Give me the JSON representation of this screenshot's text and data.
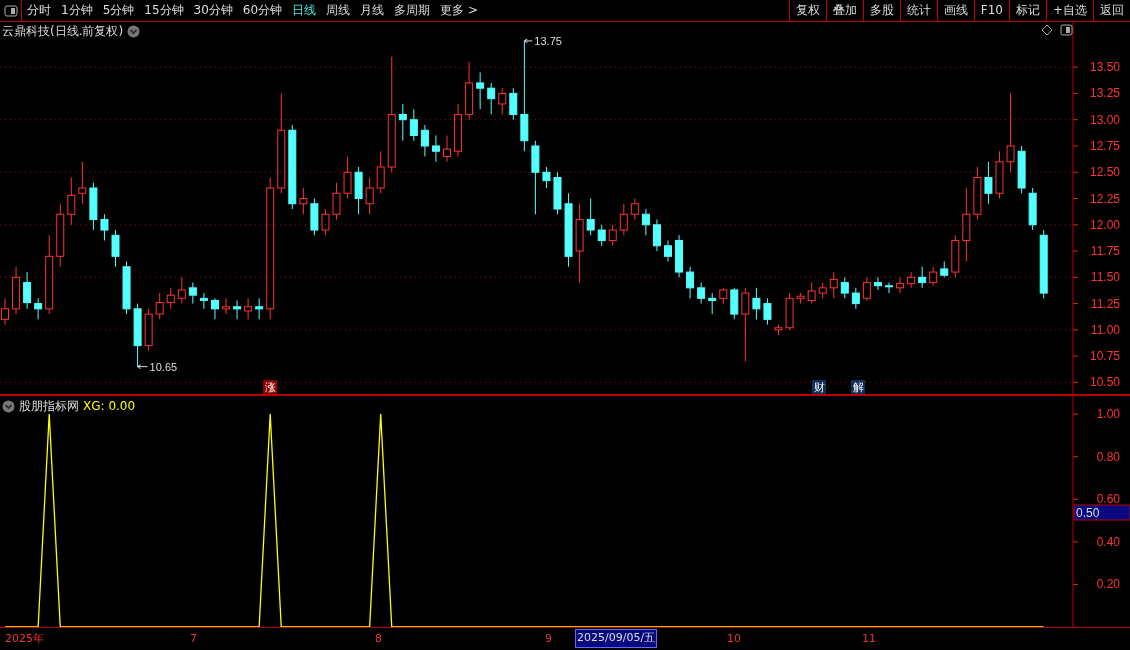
{
  "toolbar": {
    "periods": [
      {
        "label": "分时",
        "selected": false
      },
      {
        "label": "1分钟",
        "selected": false
      },
      {
        "label": "5分钟",
        "selected": false
      },
      {
        "label": "15分钟",
        "selected": false
      },
      {
        "label": "30分钟",
        "selected": false
      },
      {
        "label": "60分钟",
        "selected": false
      },
      {
        "label": "日线",
        "selected": true
      },
      {
        "label": "周线",
        "selected": false
      },
      {
        "label": "月线",
        "selected": false
      },
      {
        "label": "多周期",
        "selected": false
      },
      {
        "label": "更多 >",
        "selected": false
      }
    ],
    "actions": [
      "复权",
      "叠加",
      "多股",
      "统计",
      "画线",
      "F10",
      "标记",
      "+自选",
      "返回"
    ]
  },
  "price_panel": {
    "title": "云鼎科技(日线.前复权)",
    "high_marker": "13.75",
    "low_marker": "10.65",
    "event_badges": [
      {
        "label": "涨",
        "color": "#8b0000"
      },
      {
        "label": "财",
        "color": "#12305a"
      },
      {
        "label": "解",
        "color": "#12305a"
      }
    ],
    "chart_data": {
      "type": "candlestick",
      "grid": true,
      "ylim": [
        10.38,
        13.93
      ],
      "yticks": [
        {
          "value": 13.5,
          "label": "13.50"
        },
        {
          "value": 13.25,
          "label": "13.25"
        },
        {
          "value": 13.0,
          "label": "13.00"
        },
        {
          "value": 12.75,
          "label": "12.75"
        },
        {
          "value": 12.5,
          "label": "12.50"
        },
        {
          "value": 12.25,
          "label": "12.25"
        },
        {
          "value": 12.0,
          "label": "12.00"
        },
        {
          "value": 11.75,
          "label": "11.75"
        },
        {
          "value": 11.5,
          "label": "11.50"
        },
        {
          "value": 11.25,
          "label": "11.25"
        },
        {
          "value": 11.0,
          "label": "11.00"
        },
        {
          "value": 10.75,
          "label": "10.75"
        },
        {
          "value": 10.5,
          "label": "10.50"
        }
      ],
      "ohlc": [
        [
          11.1,
          11.3,
          11.05,
          11.2
        ],
        [
          11.2,
          11.6,
          11.15,
          11.5
        ],
        [
          11.45,
          11.55,
          11.2,
          11.26
        ],
        [
          11.25,
          11.3,
          11.1,
          11.2
        ],
        [
          11.2,
          11.9,
          11.15,
          11.7
        ],
        [
          11.7,
          12.2,
          11.6,
          12.1
        ],
        [
          12.1,
          12.45,
          12.0,
          12.28
        ],
        [
          12.3,
          12.6,
          12.2,
          12.35
        ],
        [
          12.35,
          12.4,
          11.95,
          12.05
        ],
        [
          12.05,
          12.1,
          11.85,
          11.95
        ],
        [
          11.9,
          11.95,
          11.6,
          11.7
        ],
        [
          11.6,
          11.65,
          11.15,
          11.2
        ],
        [
          11.2,
          11.25,
          10.65,
          10.85
        ],
        [
          10.85,
          11.2,
          10.8,
          11.15
        ],
        [
          11.15,
          11.35,
          11.1,
          11.26
        ],
        [
          11.26,
          11.4,
          11.2,
          11.33
        ],
        [
          11.3,
          11.5,
          11.25,
          11.38
        ],
        [
          11.4,
          11.45,
          11.25,
          11.33
        ],
        [
          11.3,
          11.35,
          11.2,
          11.28
        ],
        [
          11.28,
          11.3,
          11.1,
          11.2
        ],
        [
          11.2,
          11.3,
          11.15,
          11.22
        ],
        [
          11.22,
          11.28,
          11.1,
          11.2
        ],
        [
          11.18,
          11.3,
          11.1,
          11.22
        ],
        [
          11.22,
          11.3,
          11.1,
          11.2
        ],
        [
          11.2,
          12.45,
          11.1,
          12.35
        ],
        [
          12.35,
          13.25,
          12.3,
          12.9
        ],
        [
          12.9,
          12.95,
          12.15,
          12.2
        ],
        [
          12.2,
          12.35,
          12.1,
          12.25
        ],
        [
          12.2,
          12.25,
          11.9,
          11.95
        ],
        [
          11.95,
          12.15,
          11.9,
          12.1
        ],
        [
          12.1,
          12.4,
          12.05,
          12.3
        ],
        [
          12.3,
          12.65,
          12.25,
          12.5
        ],
        [
          12.5,
          12.55,
          12.1,
          12.25
        ],
        [
          12.2,
          12.45,
          12.1,
          12.35
        ],
        [
          12.35,
          12.7,
          12.3,
          12.55
        ],
        [
          12.55,
          13.6,
          12.5,
          13.05
        ],
        [
          13.05,
          13.15,
          12.8,
          13.0
        ],
        [
          13.0,
          13.1,
          12.8,
          12.85
        ],
        [
          12.9,
          12.95,
          12.65,
          12.75
        ],
        [
          12.75,
          12.85,
          12.6,
          12.7
        ],
        [
          12.65,
          12.85,
          12.6,
          12.72
        ],
        [
          12.7,
          13.15,
          12.65,
          13.05
        ],
        [
          13.05,
          13.55,
          13.0,
          13.35
        ],
        [
          13.35,
          13.45,
          13.1,
          13.3
        ],
        [
          13.3,
          13.35,
          13.05,
          13.2
        ],
        [
          13.15,
          13.3,
          13.05,
          13.25
        ],
        [
          13.25,
          13.3,
          13.0,
          13.05
        ],
        [
          13.05,
          13.75,
          12.7,
          12.8
        ],
        [
          12.75,
          12.8,
          12.1,
          12.5
        ],
        [
          12.5,
          12.55,
          12.35,
          12.42
        ],
        [
          12.45,
          12.5,
          12.1,
          12.15
        ],
        [
          12.2,
          12.3,
          11.6,
          11.7
        ],
        [
          11.75,
          12.2,
          11.45,
          12.05
        ],
        [
          12.05,
          12.25,
          11.9,
          11.95
        ],
        [
          11.95,
          12.0,
          11.8,
          11.85
        ],
        [
          11.85,
          12.0,
          11.8,
          11.95
        ],
        [
          11.95,
          12.2,
          11.9,
          12.1
        ],
        [
          12.1,
          12.25,
          12.05,
          12.2
        ],
        [
          12.1,
          12.15,
          11.9,
          12.0
        ],
        [
          12.0,
          12.05,
          11.75,
          11.8
        ],
        [
          11.8,
          11.85,
          11.65,
          11.7
        ],
        [
          11.85,
          11.9,
          11.5,
          11.55
        ],
        [
          11.55,
          11.6,
          11.3,
          11.4
        ],
        [
          11.4,
          11.45,
          11.25,
          11.3
        ],
        [
          11.3,
          11.35,
          11.15,
          11.28
        ],
        [
          11.3,
          11.4,
          11.25,
          11.38
        ],
        [
          11.38,
          11.4,
          11.1,
          11.15
        ],
        [
          11.15,
          11.4,
          10.7,
          11.35
        ],
        [
          11.3,
          11.4,
          11.1,
          11.2
        ],
        [
          11.25,
          11.3,
          11.05,
          11.1
        ],
        [
          11.0,
          11.05,
          10.95,
          11.02
        ],
        [
          11.02,
          11.35,
          11.0,
          11.3
        ],
        [
          11.3,
          11.35,
          11.25,
          11.32
        ],
        [
          11.28,
          11.45,
          11.25,
          11.37
        ],
        [
          11.35,
          11.45,
          11.3,
          11.4
        ],
        [
          11.4,
          11.55,
          11.3,
          11.48
        ],
        [
          11.45,
          11.5,
          11.3,
          11.35
        ],
        [
          11.35,
          11.4,
          11.2,
          11.25
        ],
        [
          11.3,
          11.5,
          11.28,
          11.45
        ],
        [
          11.45,
          11.5,
          11.38,
          11.42
        ],
        [
          11.42,
          11.45,
          11.35,
          11.41
        ],
        [
          11.4,
          11.5,
          11.35,
          11.44
        ],
        [
          11.44,
          11.55,
          11.4,
          11.5
        ],
        [
          11.5,
          11.6,
          11.4,
          11.45
        ],
        [
          11.45,
          11.6,
          11.42,
          11.55
        ],
        [
          11.58,
          11.65,
          11.5,
          11.52
        ],
        [
          11.55,
          11.9,
          11.5,
          11.85
        ],
        [
          11.85,
          12.35,
          11.65,
          12.1
        ],
        [
          12.1,
          12.55,
          12.05,
          12.45
        ],
        [
          12.45,
          12.6,
          12.2,
          12.3
        ],
        [
          12.3,
          12.7,
          12.25,
          12.6
        ],
        [
          12.6,
          13.25,
          12.5,
          12.75
        ],
        [
          12.7,
          12.75,
          12.3,
          12.35
        ],
        [
          12.3,
          12.35,
          11.95,
          12.0
        ],
        [
          11.9,
          11.95,
          11.3,
          11.35
        ]
      ]
    }
  },
  "indicator_panel": {
    "name": "股朋指标网",
    "legend": "XG: 0.00",
    "cursor_value": "0.50",
    "chart_data": {
      "type": "line",
      "ylim": [
        0,
        1.09
      ],
      "yticks": [
        {
          "value": 0.2,
          "label": "0.20"
        },
        {
          "value": 0.4,
          "label": "0.40"
        },
        {
          "value": 0.6,
          "label": "0.60"
        },
        {
          "value": 0.8,
          "label": "0.80"
        },
        {
          "value": 1.0,
          "label": "1.00"
        }
      ],
      "series": [
        {
          "color": "#ffff00",
          "values": [
            0,
            0,
            0,
            0,
            1,
            0,
            0,
            0,
            0,
            0,
            0,
            0,
            0,
            0,
            0,
            0,
            0,
            0,
            0,
            0,
            0,
            0,
            0,
            0,
            1,
            0,
            0,
            0,
            0,
            0,
            0,
            0,
            0,
            0,
            1,
            0,
            0,
            0,
            0,
            0,
            0,
            0,
            0,
            0,
            0,
            0,
            0,
            0,
            0,
            0,
            0,
            0,
            0,
            0,
            0,
            0,
            0,
            0,
            0,
            0,
            0,
            0,
            0,
            0,
            0,
            0,
            0,
            0,
            0,
            0,
            0,
            0,
            0,
            0,
            0,
            0,
            0,
            0,
            0,
            0,
            0,
            0,
            0,
            0,
            0,
            0,
            0,
            0,
            0,
            0,
            0,
            0,
            0,
            0,
            0
          ]
        }
      ]
    }
  },
  "date_axis": [
    {
      "label": "2025年",
      "selected": false
    },
    {
      "label": "7",
      "selected": false
    },
    {
      "label": "8",
      "selected": false
    },
    {
      "label": "9",
      "selected": false
    },
    {
      "label": "2025/09/05/五",
      "selected": true
    },
    {
      "label": "10",
      "selected": false
    },
    {
      "label": "11",
      "selected": false
    }
  ]
}
